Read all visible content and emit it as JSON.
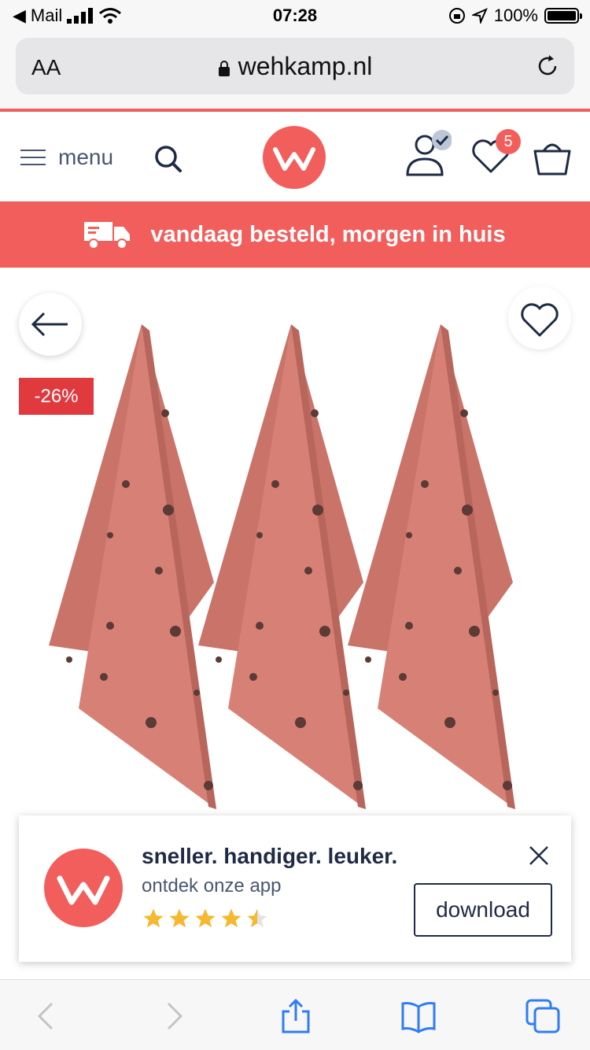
{
  "status_bar": {
    "back_app": "Mail",
    "time": "07:28",
    "battery": "100%"
  },
  "browser": {
    "text_size_label": "AA",
    "host": "wehkamp.nl"
  },
  "header": {
    "menu_label": "menu",
    "wishlist_count": "5",
    "brand_color": "#f25e5b"
  },
  "promo": {
    "text": "vandaag besteld, morgen in huis"
  },
  "product": {
    "discount": "-26%",
    "image_subject": "three pink polka-dot tea towels"
  },
  "app_banner": {
    "headline": "sneller. handiger. leuker.",
    "subtitle": "ontdek onze app",
    "rating": 4.5,
    "download_label": "download"
  },
  "icons": {
    "search": "search-icon",
    "account": "account-icon",
    "wishlist": "heart-icon",
    "cart": "basket-icon",
    "back": "arrow-left-icon",
    "close": "close-icon"
  }
}
